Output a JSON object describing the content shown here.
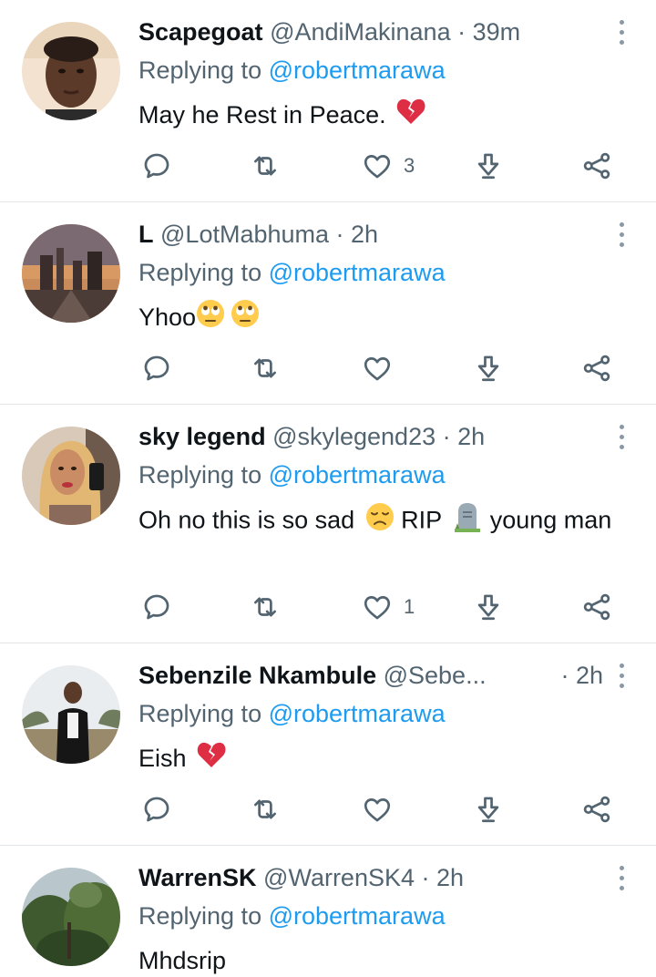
{
  "tweets": [
    {
      "name": "Scapegoat",
      "handle": "@AndiMakinana",
      "time": "· 39m",
      "replying_label": "Replying to",
      "replying_to": "@robertmarawa",
      "text": "May he Rest in Peace.",
      "emoji": "broken-heart",
      "likes": "3"
    },
    {
      "name": "L",
      "handle": "@LotMabhuma",
      "time": "· 2h",
      "replying_label": "Replying to",
      "replying_to": "@robertmarawa",
      "text": "Yhoo",
      "emoji": "face-with-rolling-eyes",
      "likes": ""
    },
    {
      "name": "sky legend",
      "handle": "@skylegend23",
      "time": "· 2h",
      "replying_label": "Replying to",
      "replying_to": "@robertmarawa",
      "text_a": "Oh no this is so sad",
      "text_b": "RIP",
      "text_c": "young man",
      "emoji": [
        "disappointed-face",
        "headstone"
      ],
      "likes": "1"
    },
    {
      "name": "Sebenzile Nkambule",
      "handle": "@Sebe...",
      "time": "· 2h",
      "replying_label": "Replying to",
      "replying_to": "@robertmarawa",
      "text": "Eish",
      "emoji": "broken-heart",
      "likes": ""
    },
    {
      "name": "WarrenSK",
      "handle": "@WarrenSK4",
      "time": "· 2h",
      "replying_label": "Replying to",
      "replying_to": "@robertmarawa",
      "text": "Mhdsrip"
    }
  ],
  "icons": {
    "reply": "reply-icon",
    "retweet": "retweet-icon",
    "like": "heart-icon",
    "download": "download-icon",
    "share": "share-icon",
    "more": "more-vertical-icon"
  },
  "colors": {
    "mention": "#1d9bf0",
    "secondary_text": "#536471",
    "icon": "#536471",
    "divider": "#e3e6e9"
  }
}
